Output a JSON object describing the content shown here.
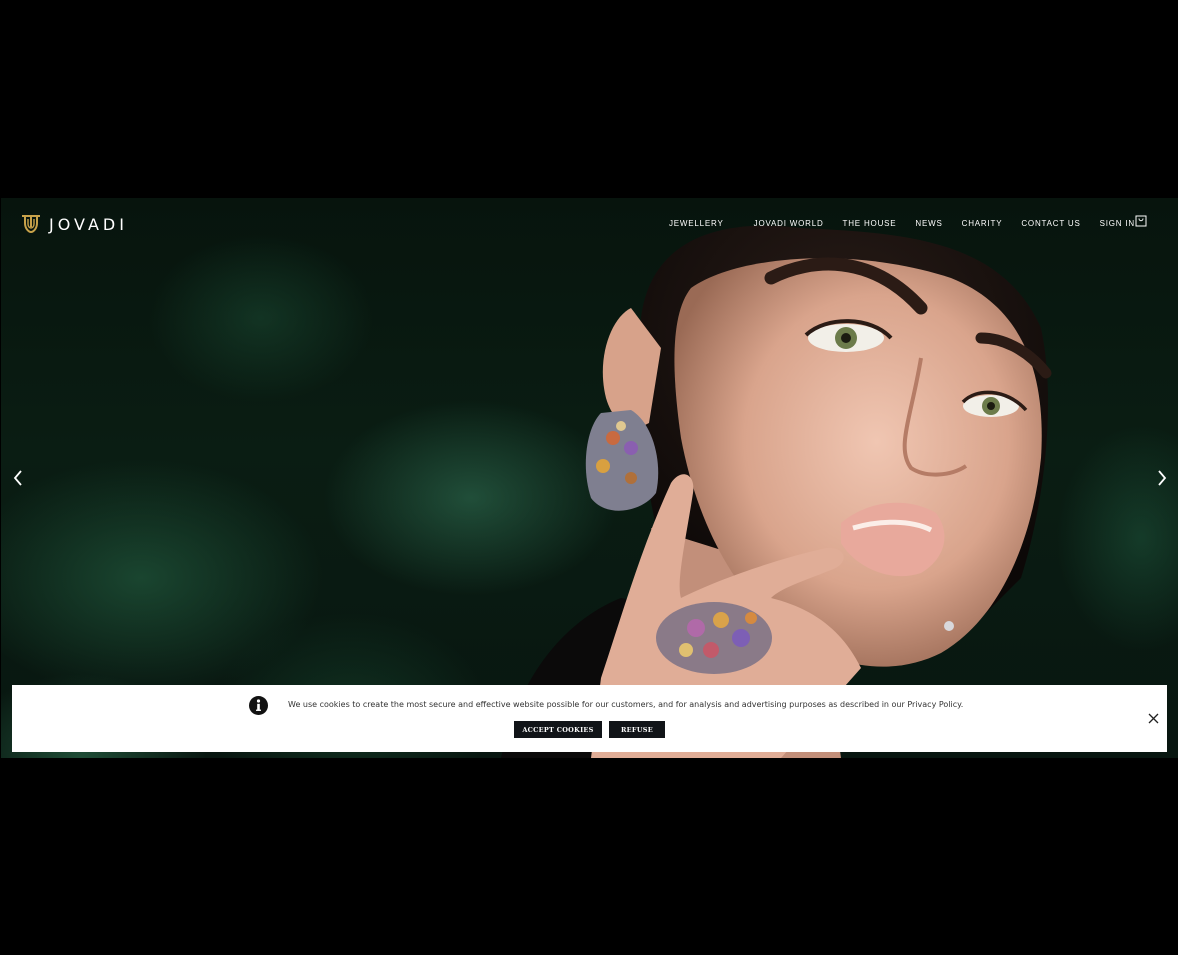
{
  "brand": {
    "name": "JOVADI",
    "logo_icon": "jovadi-monogram-icon",
    "accent_color": "#c8a24a"
  },
  "nav": {
    "items": [
      {
        "label": "JEWELLERY"
      },
      {
        "label": "JOVADI WORLD"
      },
      {
        "label": "THE HOUSE"
      },
      {
        "label": "NEWS"
      },
      {
        "label": "CHARITY"
      },
      {
        "label": "CONTACT US"
      },
      {
        "label": "SIGN IN"
      }
    ],
    "cart_icon": "shopping-bag-icon"
  },
  "hero": {
    "prev_icon": "chevron-left-icon",
    "next_icon": "chevron-right-icon"
  },
  "cookie_banner": {
    "info_icon": "info-icon",
    "message": "We use cookies to create the most secure and effective website possible for our customers, and for analysis and advertising purposes as described in our Privacy Policy.",
    "accept_label": "ACCEPT COOKIES",
    "refuse_label": "REFUSE",
    "close_icon": "close-icon"
  }
}
